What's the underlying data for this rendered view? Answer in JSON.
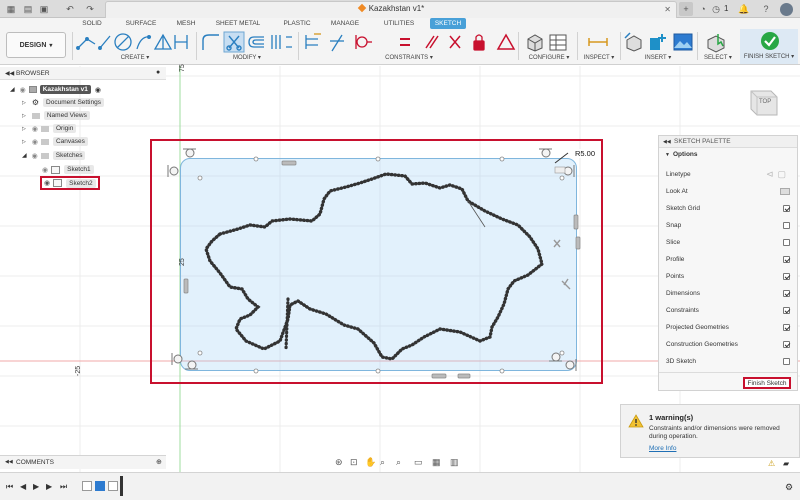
{
  "titlebar": {
    "doc_title": "Kazakhstan v1*",
    "counter": "1",
    "help_label": "?"
  },
  "workspace_tabs": [
    {
      "label": "SOLID"
    },
    {
      "label": "SURFACE"
    },
    {
      "label": "MESH"
    },
    {
      "label": "SHEET METAL"
    },
    {
      "label": "PLASTIC"
    },
    {
      "label": "MANAGE"
    },
    {
      "label": "UTILITIES"
    },
    {
      "label": "SKETCH"
    }
  ],
  "toolbar": {
    "design_label": "DESIGN",
    "groups": {
      "create": "CREATE",
      "modify": "MODIFY",
      "constraints": "CONSTRAINTS",
      "configure": "CONFIGURE",
      "inspect": "INSPECT",
      "insert": "INSERT",
      "select": "SELECT",
      "finish": "FINISH SKETCH"
    }
  },
  "browser": {
    "title": "BROWSER",
    "items": [
      {
        "label": "Kazakhstan v1"
      },
      {
        "label": "Document Settings"
      },
      {
        "label": "Named Views"
      },
      {
        "label": "Origin"
      },
      {
        "label": "Canvases"
      },
      {
        "label": "Sketches"
      },
      {
        "label": "Sketch1"
      },
      {
        "label": "Sketch2"
      }
    ]
  },
  "viewport": {
    "viewcube_label": "TOP",
    "dimension_label": "R5.00",
    "axis_top": "75",
    "axis_mid": "25",
    "axis_neg": "-25"
  },
  "palette": {
    "title": "SKETCH PALETTE",
    "section": "Options",
    "rows": [
      {
        "label": "Linetype",
        "checked": false
      },
      {
        "label": "Look At",
        "checked": false
      },
      {
        "label": "Sketch Grid",
        "checked": true
      },
      {
        "label": "Snap",
        "checked": false
      },
      {
        "label": "Slice",
        "checked": false
      },
      {
        "label": "Profile",
        "checked": true
      },
      {
        "label": "Points",
        "checked": true
      },
      {
        "label": "Dimensions",
        "checked": true
      },
      {
        "label": "Constraints",
        "checked": true
      },
      {
        "label": "Projected Geometries",
        "checked": true
      },
      {
        "label": "Construction Geometries",
        "checked": true
      },
      {
        "label": "3D Sketch",
        "checked": false
      }
    ],
    "finish_label": "Finish Sketch"
  },
  "warning": {
    "title": "1 warning(s)",
    "message": "Constraints and/or dimensions were removed during operation.",
    "link": "More Info"
  },
  "comments": {
    "title": "COMMENTS"
  },
  "colors": {
    "accent": "#48a0d8",
    "highlight": "#c8102e",
    "profile_fill": "#d7ebfa",
    "finish_green": "#28a745"
  }
}
